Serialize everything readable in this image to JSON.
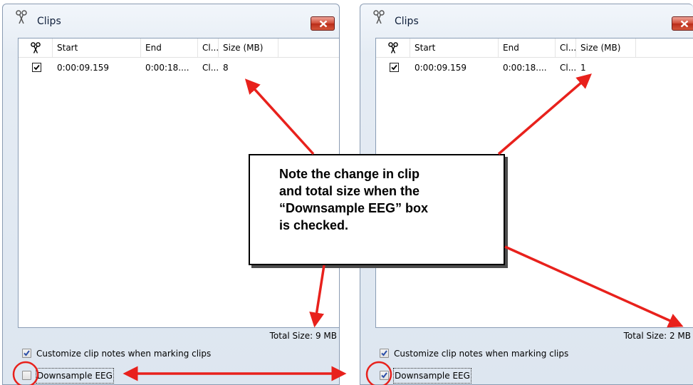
{
  "panels": [
    {
      "title": "Clips",
      "columns": [
        "Start",
        "End",
        "Cl...",
        "Size (MB)"
      ],
      "row": {
        "checked": true,
        "start": "0:00:09.159",
        "end": "0:00:18....",
        "cl": "Cl...",
        "size": "8"
      },
      "total_size": "Total Size: 9 MB",
      "options": [
        {
          "label": "Customize clip notes when marking clips",
          "checked": true
        },
        {
          "label": "Downsample EEG",
          "checked": false
        }
      ]
    },
    {
      "title": "Clips",
      "columns": [
        "Start",
        "End",
        "Cl...",
        "Size (MB)"
      ],
      "row": {
        "checked": true,
        "start": "0:00:09.159",
        "end": "0:00:18....",
        "cl": "Cl...",
        "size": "1"
      },
      "total_size": "Total Size: 2 MB",
      "options": [
        {
          "label": "Customize clip notes when marking clips",
          "checked": true
        },
        {
          "label": "Downsample EEG",
          "checked": true
        }
      ]
    }
  ],
  "callout": {
    "lines": [
      "Note the change in clip",
      "and total size when the",
      "“Downsample EEG” box",
      "is checked."
    ]
  },
  "annotation_color": "#e8211c",
  "icons": [
    "scissors-icon",
    "close-icon",
    "checkmark-icon",
    "arrow-icon",
    "circle-highlight"
  ]
}
